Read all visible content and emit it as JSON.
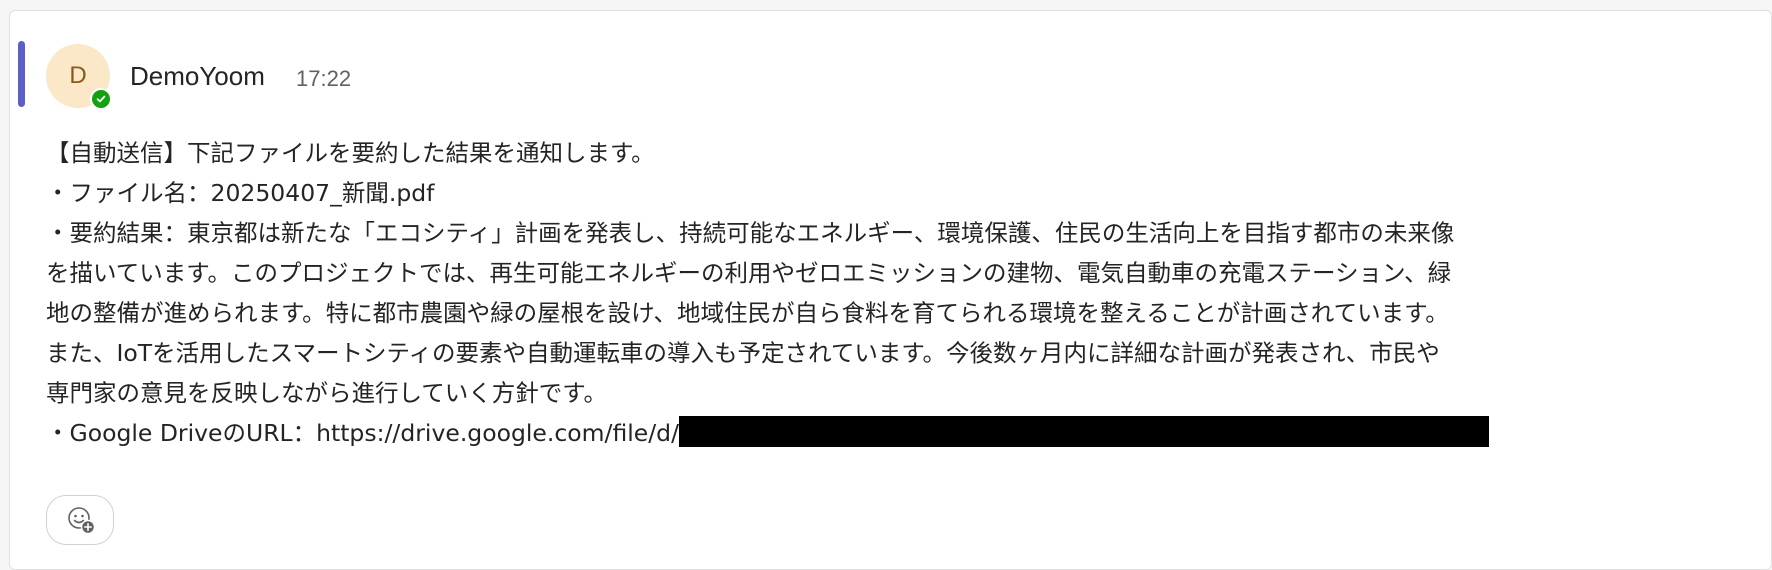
{
  "message": {
    "avatar_initial": "D",
    "sender": "DemoYoom",
    "timestamp": "17:22",
    "lines": [
      "【自動送信】下記ファイルを要約した結果を通知します。",
      "・ファイル名：20250407_新聞.pdf",
      "・要約結果：東京都は新たな「エコシティ」計画を発表し、持続可能なエネルギー、環境保護、住民の生活向上を目指す都市の未来像",
      "を描いています。このプロジェクトでは、再生可能エネルギーの利用やゼロエミッションの建物、電気自動車の充電ステーション、緑",
      "地の整備が進められます。特に都市農園や緑の屋根を設け、地域住民が自ら食料を育てられる環境を整えることが計画されています。",
      "また、IoTを活用したスマートシティの要素や自動運転車の導入も予定されています。今後数ヶ月内に詳細な計画が発表され、市民や",
      "専門家の意見を反映しながら進行していく方針です。"
    ],
    "url_line_prefix": "・Google DriveのURL：https://drive.google.com/file/d/"
  },
  "icons": {
    "presence": "checkmark-icon",
    "reaction": "add-reaction-icon"
  },
  "colors": {
    "accent": "#5b5fc7",
    "avatar_bg": "#fbe8c9",
    "avatar_text": "#8a5a1a",
    "presence_available": "#13a10e"
  }
}
